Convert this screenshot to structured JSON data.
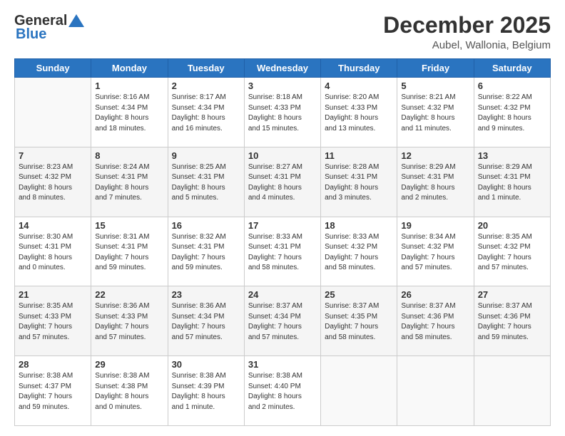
{
  "header": {
    "logo_general": "General",
    "logo_blue": "Blue",
    "title": "December 2025",
    "subtitle": "Aubel, Wallonia, Belgium"
  },
  "days_header": [
    "Sunday",
    "Monday",
    "Tuesday",
    "Wednesday",
    "Thursday",
    "Friday",
    "Saturday"
  ],
  "weeks": [
    [
      {
        "day": "",
        "info": ""
      },
      {
        "day": "1",
        "info": "Sunrise: 8:16 AM\nSunset: 4:34 PM\nDaylight: 8 hours\nand 18 minutes."
      },
      {
        "day": "2",
        "info": "Sunrise: 8:17 AM\nSunset: 4:34 PM\nDaylight: 8 hours\nand 16 minutes."
      },
      {
        "day": "3",
        "info": "Sunrise: 8:18 AM\nSunset: 4:33 PM\nDaylight: 8 hours\nand 15 minutes."
      },
      {
        "day": "4",
        "info": "Sunrise: 8:20 AM\nSunset: 4:33 PM\nDaylight: 8 hours\nand 13 minutes."
      },
      {
        "day": "5",
        "info": "Sunrise: 8:21 AM\nSunset: 4:32 PM\nDaylight: 8 hours\nand 11 minutes."
      },
      {
        "day": "6",
        "info": "Sunrise: 8:22 AM\nSunset: 4:32 PM\nDaylight: 8 hours\nand 9 minutes."
      }
    ],
    [
      {
        "day": "7",
        "info": "Sunrise: 8:23 AM\nSunset: 4:32 PM\nDaylight: 8 hours\nand 8 minutes."
      },
      {
        "day": "8",
        "info": "Sunrise: 8:24 AM\nSunset: 4:31 PM\nDaylight: 8 hours\nand 7 minutes."
      },
      {
        "day": "9",
        "info": "Sunrise: 8:25 AM\nSunset: 4:31 PM\nDaylight: 8 hours\nand 5 minutes."
      },
      {
        "day": "10",
        "info": "Sunrise: 8:27 AM\nSunset: 4:31 PM\nDaylight: 8 hours\nand 4 minutes."
      },
      {
        "day": "11",
        "info": "Sunrise: 8:28 AM\nSunset: 4:31 PM\nDaylight: 8 hours\nand 3 minutes."
      },
      {
        "day": "12",
        "info": "Sunrise: 8:29 AM\nSunset: 4:31 PM\nDaylight: 8 hours\nand 2 minutes."
      },
      {
        "day": "13",
        "info": "Sunrise: 8:29 AM\nSunset: 4:31 PM\nDaylight: 8 hours\nand 1 minute."
      }
    ],
    [
      {
        "day": "14",
        "info": "Sunrise: 8:30 AM\nSunset: 4:31 PM\nDaylight: 8 hours\nand 0 minutes."
      },
      {
        "day": "15",
        "info": "Sunrise: 8:31 AM\nSunset: 4:31 PM\nDaylight: 7 hours\nand 59 minutes."
      },
      {
        "day": "16",
        "info": "Sunrise: 8:32 AM\nSunset: 4:31 PM\nDaylight: 7 hours\nand 59 minutes."
      },
      {
        "day": "17",
        "info": "Sunrise: 8:33 AM\nSunset: 4:31 PM\nDaylight: 7 hours\nand 58 minutes."
      },
      {
        "day": "18",
        "info": "Sunrise: 8:33 AM\nSunset: 4:32 PM\nDaylight: 7 hours\nand 58 minutes."
      },
      {
        "day": "19",
        "info": "Sunrise: 8:34 AM\nSunset: 4:32 PM\nDaylight: 7 hours\nand 57 minutes."
      },
      {
        "day": "20",
        "info": "Sunrise: 8:35 AM\nSunset: 4:32 PM\nDaylight: 7 hours\nand 57 minutes."
      }
    ],
    [
      {
        "day": "21",
        "info": "Sunrise: 8:35 AM\nSunset: 4:33 PM\nDaylight: 7 hours\nand 57 minutes."
      },
      {
        "day": "22",
        "info": "Sunrise: 8:36 AM\nSunset: 4:33 PM\nDaylight: 7 hours\nand 57 minutes."
      },
      {
        "day": "23",
        "info": "Sunrise: 8:36 AM\nSunset: 4:34 PM\nDaylight: 7 hours\nand 57 minutes."
      },
      {
        "day": "24",
        "info": "Sunrise: 8:37 AM\nSunset: 4:34 PM\nDaylight: 7 hours\nand 57 minutes."
      },
      {
        "day": "25",
        "info": "Sunrise: 8:37 AM\nSunset: 4:35 PM\nDaylight: 7 hours\nand 58 minutes."
      },
      {
        "day": "26",
        "info": "Sunrise: 8:37 AM\nSunset: 4:36 PM\nDaylight: 7 hours\nand 58 minutes."
      },
      {
        "day": "27",
        "info": "Sunrise: 8:37 AM\nSunset: 4:36 PM\nDaylight: 7 hours\nand 59 minutes."
      }
    ],
    [
      {
        "day": "28",
        "info": "Sunrise: 8:38 AM\nSunset: 4:37 PM\nDaylight: 7 hours\nand 59 minutes."
      },
      {
        "day": "29",
        "info": "Sunrise: 8:38 AM\nSunset: 4:38 PM\nDaylight: 8 hours\nand 0 minutes."
      },
      {
        "day": "30",
        "info": "Sunrise: 8:38 AM\nSunset: 4:39 PM\nDaylight: 8 hours\nand 1 minute."
      },
      {
        "day": "31",
        "info": "Sunrise: 8:38 AM\nSunset: 4:40 PM\nDaylight: 8 hours\nand 2 minutes."
      },
      {
        "day": "",
        "info": ""
      },
      {
        "day": "",
        "info": ""
      },
      {
        "day": "",
        "info": ""
      }
    ]
  ]
}
